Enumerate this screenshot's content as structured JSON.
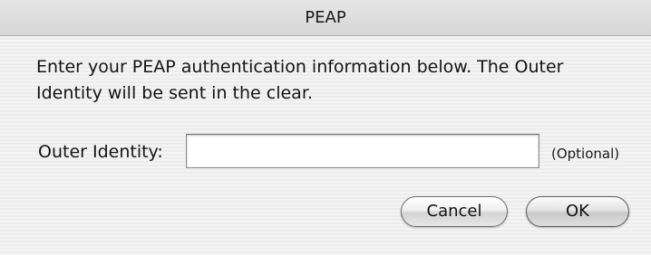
{
  "window": {
    "title": "PEAP"
  },
  "message": "Enter your PEAP authentication information below. The Outer Identity will be sent in the clear.",
  "outer_identity": {
    "label": "Outer Identity:",
    "value": "",
    "placeholder": "",
    "hint": "(Optional)"
  },
  "buttons": {
    "cancel_label": "Cancel",
    "ok_label": "OK"
  }
}
